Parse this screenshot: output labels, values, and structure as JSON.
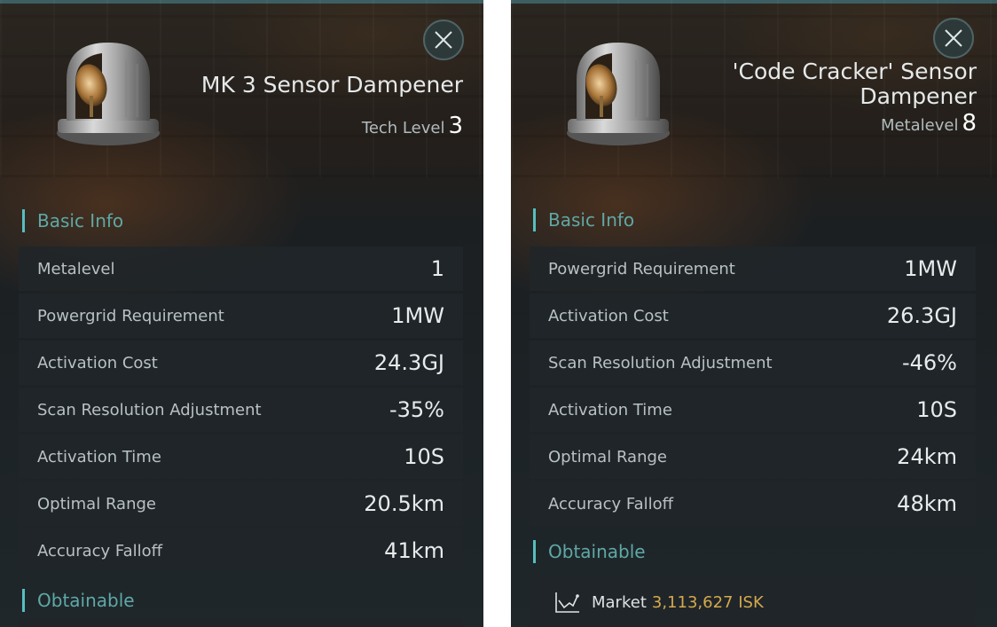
{
  "left_panel": {
    "title": "MK 3 Sensor Dampener",
    "level_label": "Tech Level",
    "level_value": "3",
    "basic_info_header": "Basic Info",
    "stats": [
      {
        "label": "Metalevel",
        "value": "1"
      },
      {
        "label": "Powergrid Requirement",
        "value": "1MW"
      },
      {
        "label": "Activation Cost",
        "value": "24.3GJ"
      },
      {
        "label": "Scan Resolution Adjustment",
        "value": "-35%"
      },
      {
        "label": "Activation Time",
        "value": "10S"
      },
      {
        "label": "Optimal Range",
        "value": "20.5km"
      },
      {
        "label": "Accuracy Falloff",
        "value": "41km"
      }
    ],
    "obtainable_header": "Obtainable"
  },
  "right_panel": {
    "title": "'Code Cracker' Sensor Dampener",
    "level_label": "Metalevel",
    "level_value": "8",
    "basic_info_header": "Basic Info",
    "stats": [
      {
        "label": "Powergrid Requirement",
        "value": "1MW"
      },
      {
        "label": "Activation Cost",
        "value": "26.3GJ"
      },
      {
        "label": "Scan Resolution Adjustment",
        "value": "-46%"
      },
      {
        "label": "Activation Time",
        "value": "10S"
      },
      {
        "label": "Optimal Range",
        "value": "24km"
      },
      {
        "label": "Accuracy Falloff",
        "value": "48km"
      }
    ],
    "obtainable_header": "Obtainable",
    "market": {
      "label": "Market",
      "price": "3,113,627 ISK"
    }
  },
  "icons": {
    "close": "close-icon",
    "module": "sensor-dampener-module-icon",
    "market": "market-chart-icon"
  },
  "colors": {
    "accent": "#55bfc0",
    "section_text": "#5fa8a6",
    "price": "#d4aa4c"
  }
}
